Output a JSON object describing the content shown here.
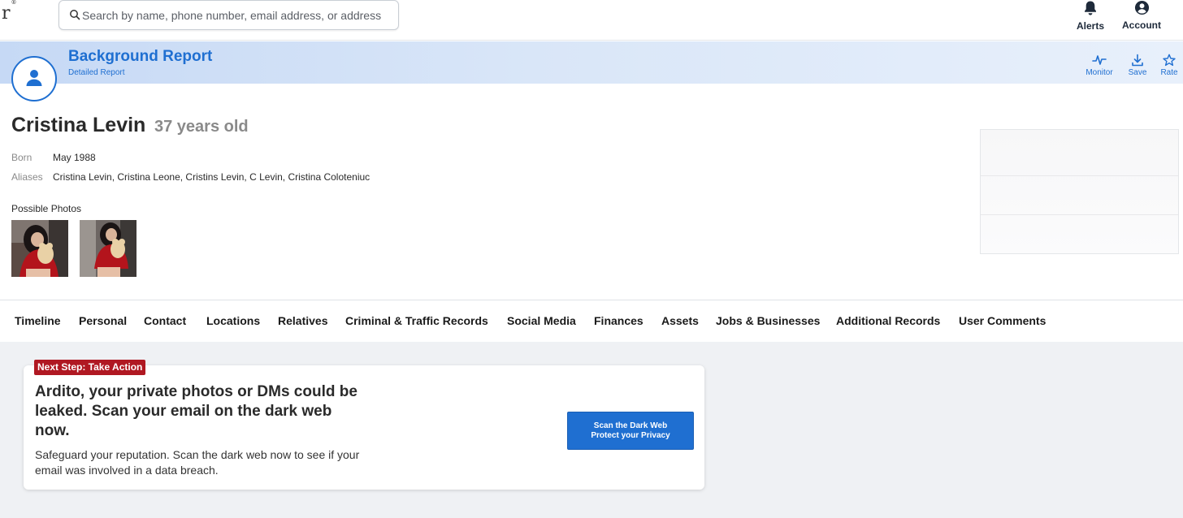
{
  "brand": {
    "logo_text": "r",
    "logo_mark": "®"
  },
  "search": {
    "placeholder": "Search by name, phone number, email address, or address",
    "icon": "search-icon"
  },
  "topnav": {
    "alerts_label": "Alerts",
    "account_label": "Account"
  },
  "report": {
    "title": "Background Report",
    "subtitle": "Detailed Report",
    "actions": {
      "monitor": "Monitor",
      "save": "Save",
      "rate": "Rate"
    }
  },
  "person": {
    "name": "Cristina Levin",
    "age": "37 years old",
    "born_label": "Born",
    "born_value": "May 1988",
    "aliases_label": "Aliases",
    "aliases_value": "Cristina Levin, Cristina Leone, Cristins Levin, C Levin, Cristina Coloteniuc",
    "photos_title": "Possible Photos"
  },
  "tabs": [
    "Timeline",
    "Personal",
    "Contact",
    "Locations",
    "Relatives",
    "Criminal & Traffic Records",
    "Social Media",
    "Finances",
    "Assets",
    "Jobs & Businesses",
    "Additional Records",
    "User Comments"
  ],
  "promo": {
    "badge": "Next Step: Take Action",
    "heading": "Ardito, your private photos or DMs could be leaked. Scan your email on the dark web now.",
    "body": "Safeguard your reputation. Scan the dark web now to see if your email was involved in a data breach.",
    "button_line1": "Scan the Dark Web",
    "button_line2": "Protect your Privacy"
  },
  "colors": {
    "accent": "#1f6fd1",
    "badge": "#b01822",
    "band": "#c6d9f5",
    "page_bg": "#eff1f4"
  }
}
